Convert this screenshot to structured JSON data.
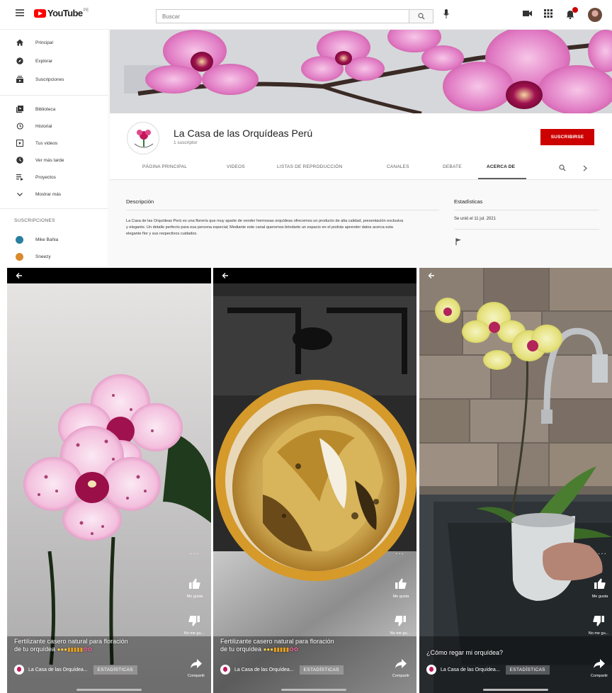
{
  "topbar": {
    "logo_text": "YouTube",
    "logo_sup": "PE",
    "search_placeholder": "Buscar"
  },
  "sidebar": {
    "items": [
      {
        "label": "Principal",
        "icon": "home-icon"
      },
      {
        "label": "Explorar",
        "icon": "explore-icon"
      },
      {
        "label": "Suscripciones",
        "icon": "subscriptions-icon"
      },
      {
        "label": "Biblioteca",
        "icon": "library-icon"
      },
      {
        "label": "Historial",
        "icon": "history-icon"
      },
      {
        "label": "Tus videos",
        "icon": "your-videos-icon"
      },
      {
        "label": "Ver más tarde",
        "icon": "watch-later-icon"
      },
      {
        "label": "Proyectos",
        "icon": "projects-icon"
      },
      {
        "label": "Mostrar más",
        "icon": "chevron-down-icon"
      }
    ],
    "subscriptions_title": "SUSCRIPCIONES",
    "subscriptions": [
      {
        "name": "Mike Bahia",
        "color": "#2a7fa0"
      },
      {
        "name": "Sneezy",
        "color": "#d98a2b"
      }
    ]
  },
  "channel": {
    "name": "La Casa de las Orquídeas Perú",
    "subscribers": "1 suscriptor",
    "subscribe_label": "SUSCRIBIRSE",
    "accent": "#cc0000",
    "tabs": [
      "PÁGINA PRINCIPAL",
      "VIDEOS",
      "LISTAS DE REPRODUCCIÓN",
      "CANALES",
      "DEBATE",
      "ACERCA DE"
    ],
    "active_tab": "ACERCA DE"
  },
  "about": {
    "description_title": "Descripción",
    "description": "La Casa de las Orquídeas Perú es una florería que muy aparte de vender hermosas orquídeas ofrecemos un producto de alta calidad, presentación exclusiva y elegante. Un detalle perfecto para esa persona especial; Mediante este canal queremos brindarte un espacio en el podrás aprender datos acerca esta elegante flor y sus respectivos cuidados.",
    "stats_title": "Estadísticas",
    "joined": "Se unió el 11 jul. 2021"
  },
  "shorts": [
    {
      "caption_line1": "Fertilizante casero natural para floración",
      "caption_line2": "de tu orquídea",
      "channel": "La Casa de las Orquídea...",
      "stats_label": "ESTADÍSTICAS",
      "like_label": "Me gusta",
      "dislike_label": "No me gu...",
      "share_label": "Compartir"
    },
    {
      "caption_line1": "Fertilizante casero natural para floración",
      "caption_line2": "de tu orquídea",
      "channel": "La Casa de las Orquídea...",
      "stats_label": "ESTADÍSTICAS",
      "like_label": "Me gusta",
      "dislike_label": "No me gu...",
      "share_label": "Compartir"
    },
    {
      "caption_line1": "¿Cómo regar mi orquídea?",
      "caption_line2": "",
      "channel": "La Casa de las Orquídea...",
      "stats_label": "ESTADÍSTICAS",
      "like_label": "Me gusta",
      "dislike_label": "No me gu...",
      "share_label": "Compartir"
    }
  ]
}
